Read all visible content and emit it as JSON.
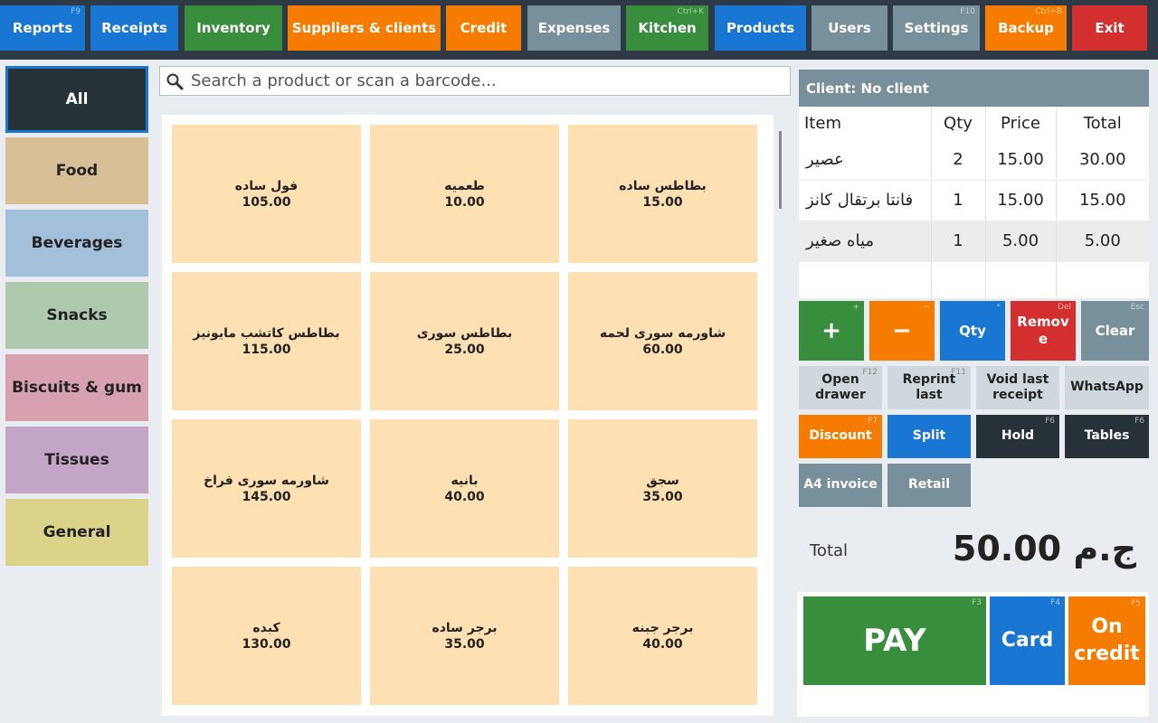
{
  "toolbar": {
    "buttons": [
      {
        "label": "Reports",
        "hotkey": "F9"
      },
      {
        "label": "Receipts",
        "hotkey": ""
      },
      {
        "label": "Inventory",
        "hotkey": ""
      },
      {
        "label": "Suppliers & clients",
        "hotkey": ""
      },
      {
        "label": "Credit",
        "hotkey": ""
      },
      {
        "label": "Expenses",
        "hotkey": ""
      },
      {
        "label": "Kitchen",
        "hotkey": "Ctrl+K"
      },
      {
        "label": "Products",
        "hotkey": ""
      },
      {
        "label": "Users",
        "hotkey": ""
      },
      {
        "label": "Settings",
        "hotkey": "F10"
      },
      {
        "label": "Backup",
        "hotkey": "Ctrl+B"
      },
      {
        "label": "Exit",
        "hotkey": ""
      }
    ]
  },
  "categories": [
    {
      "label": "All",
      "color": "#263238"
    },
    {
      "label": "Food",
      "color": "#d7bf96"
    },
    {
      "label": "Beverages",
      "color": "#a3bfd9"
    },
    {
      "label": "Snacks",
      "color": "#afc9ae"
    },
    {
      "label": "Biscuits & gum",
      "color": "#d8a1b0"
    },
    {
      "label": "Tissues",
      "color": "#c2a5c7"
    },
    {
      "label": "General",
      "color": "#dbd38a"
    }
  ],
  "search": {
    "placeholder": "Search a product or scan a barcode..."
  },
  "products": [
    {
      "name": "فول ساده",
      "price": "105.00"
    },
    {
      "name": "طعميه",
      "price": "10.00"
    },
    {
      "name": "بطاطس ساده",
      "price": "15.00"
    },
    {
      "name": "بطاطس كاتشب مايونيز",
      "price": "115.00"
    },
    {
      "name": "بطاطس سورى",
      "price": "25.00"
    },
    {
      "name": "شاورمه سورى لحمه",
      "price": "60.00"
    },
    {
      "name": "شاورمه سورى فراخ",
      "price": "145.00"
    },
    {
      "name": "بانيه",
      "price": "40.00"
    },
    {
      "name": "سجق",
      "price": "35.00"
    },
    {
      "name": "كبده",
      "price": "130.00"
    },
    {
      "name": "برجر ساده",
      "price": "35.00"
    },
    {
      "name": "برجر جبنه",
      "price": "40.00"
    }
  ],
  "client": {
    "label": "Client: No client"
  },
  "cart": {
    "columns": [
      "Item",
      "Qty",
      "Price",
      "Total"
    ],
    "rows": [
      {
        "item": "عصير",
        "qty": "2",
        "price": "15.00",
        "total": "30.00"
      },
      {
        "item": "فانتا برتقال كانز",
        "qty": "1",
        "price": "15.00",
        "total": "15.00"
      },
      {
        "item": "مياه صغير",
        "qty": "1",
        "price": "5.00",
        "total": "5.00"
      }
    ]
  },
  "actions": {
    "plus": {
      "label": "+",
      "hotkey": "+"
    },
    "minus": {
      "label": "−",
      "hotkey": "−"
    },
    "qty": {
      "label": "Qty",
      "hotkey": "*"
    },
    "remove": {
      "label": "Remove",
      "hotkey": "Del"
    },
    "clear": {
      "label": "Clear",
      "hotkey": "Esc"
    },
    "open_drawer": {
      "label": "Open drawer",
      "hotkey": "F12"
    },
    "reprint_last": {
      "label": "Reprint last",
      "hotkey": "F11"
    },
    "void_last": {
      "label": "Void last receipt",
      "hotkey": ""
    },
    "whatsapp": {
      "label": "WhatsApp",
      "hotkey": ""
    },
    "discount": {
      "label": "Discount",
      "hotkey": "F7"
    },
    "split": {
      "label": "Split",
      "hotkey": ""
    },
    "hold": {
      "label": "Hold",
      "hotkey": "F6"
    },
    "tables": {
      "label": "Tables",
      "hotkey": "F6"
    },
    "a4_invoice": {
      "label": "A4 invoice",
      "hotkey": ""
    },
    "retail": {
      "label": "Retail",
      "hotkey": ""
    }
  },
  "totals": {
    "label": "Total",
    "value": "ج.م 50.00"
  },
  "payment": {
    "pay": {
      "label": "PAY",
      "hotkey": "F3"
    },
    "card": {
      "label": "Card",
      "hotkey": "F4"
    },
    "on_credit": {
      "label": "On credit",
      "hotkey": "F5"
    }
  }
}
